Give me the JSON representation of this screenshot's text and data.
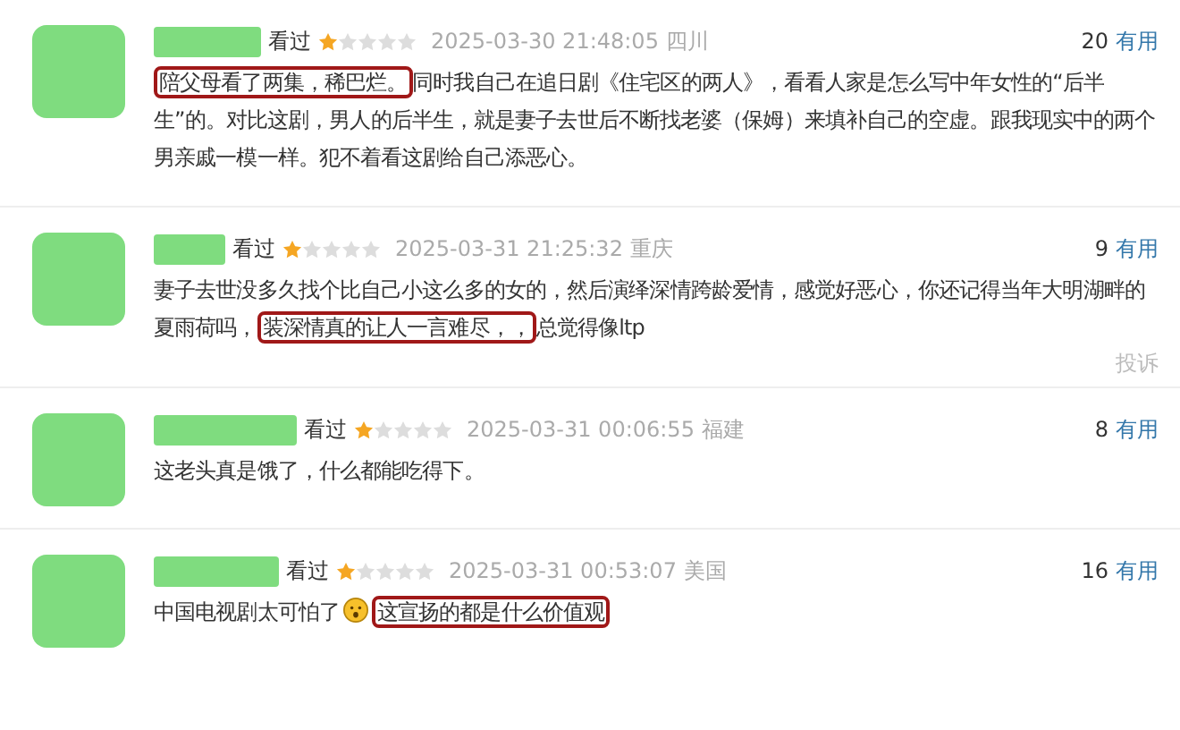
{
  "reviews": [
    {
      "status": "看过",
      "stars": 1,
      "time": "2025-03-30 21:48:05",
      "location": "四川",
      "votes": "20",
      "vote_label": "有用",
      "body": [
        {
          "kind": "text",
          "text": "陪父母看了两集，稀巴烂。",
          "circled": true
        },
        {
          "kind": "text",
          "text": "同时我自己在追日剧《住宅区的两人》，看看人家是怎么写中年女性的“后半生”的。对比这剧，男人的后半生，就是妻子去世后不断找老婆（保姆）来填补自己的空虚。跟我现实中的两个男亲戚一模一样。犯不着看这剧给自己添恶心。",
          "circled": false
        }
      ]
    },
    {
      "status": "看过",
      "stars": 1,
      "time": "2025-03-31 21:25:32",
      "location": "重庆",
      "votes": "9",
      "vote_label": "有用",
      "report": "投诉",
      "body": [
        {
          "kind": "text",
          "text": "妻子去世没多久找个比自己小这么多的女的，然后演绎深情跨龄爱情，感觉好恶心，你还记得当年大明湖畔的夏雨荷吗，",
          "circled": false
        },
        {
          "kind": "text",
          "text": "装深情真的让人一言难尽，，",
          "circled": true
        },
        {
          "kind": "text",
          "text": "总觉得像ltp",
          "circled": false
        }
      ]
    },
    {
      "status": "看过",
      "stars": 1,
      "time": "2025-03-31 00:06:55",
      "location": "福建",
      "votes": "8",
      "vote_label": "有用",
      "body": [
        {
          "kind": "text",
          "text": "这老头真是饿了，什么都能吃得下。",
          "circled": false
        }
      ]
    },
    {
      "status": "看过",
      "stars": 1,
      "time": "2025-03-31 00:53:07",
      "location": "美国",
      "votes": "16",
      "vote_label": "有用",
      "body": [
        {
          "kind": "text",
          "text": "中国电视剧太可怕了",
          "circled": false
        },
        {
          "kind": "emoji"
        },
        {
          "kind": "text",
          "text": "这宣扬的都是什么价值观",
          "circled": true
        }
      ]
    }
  ]
}
